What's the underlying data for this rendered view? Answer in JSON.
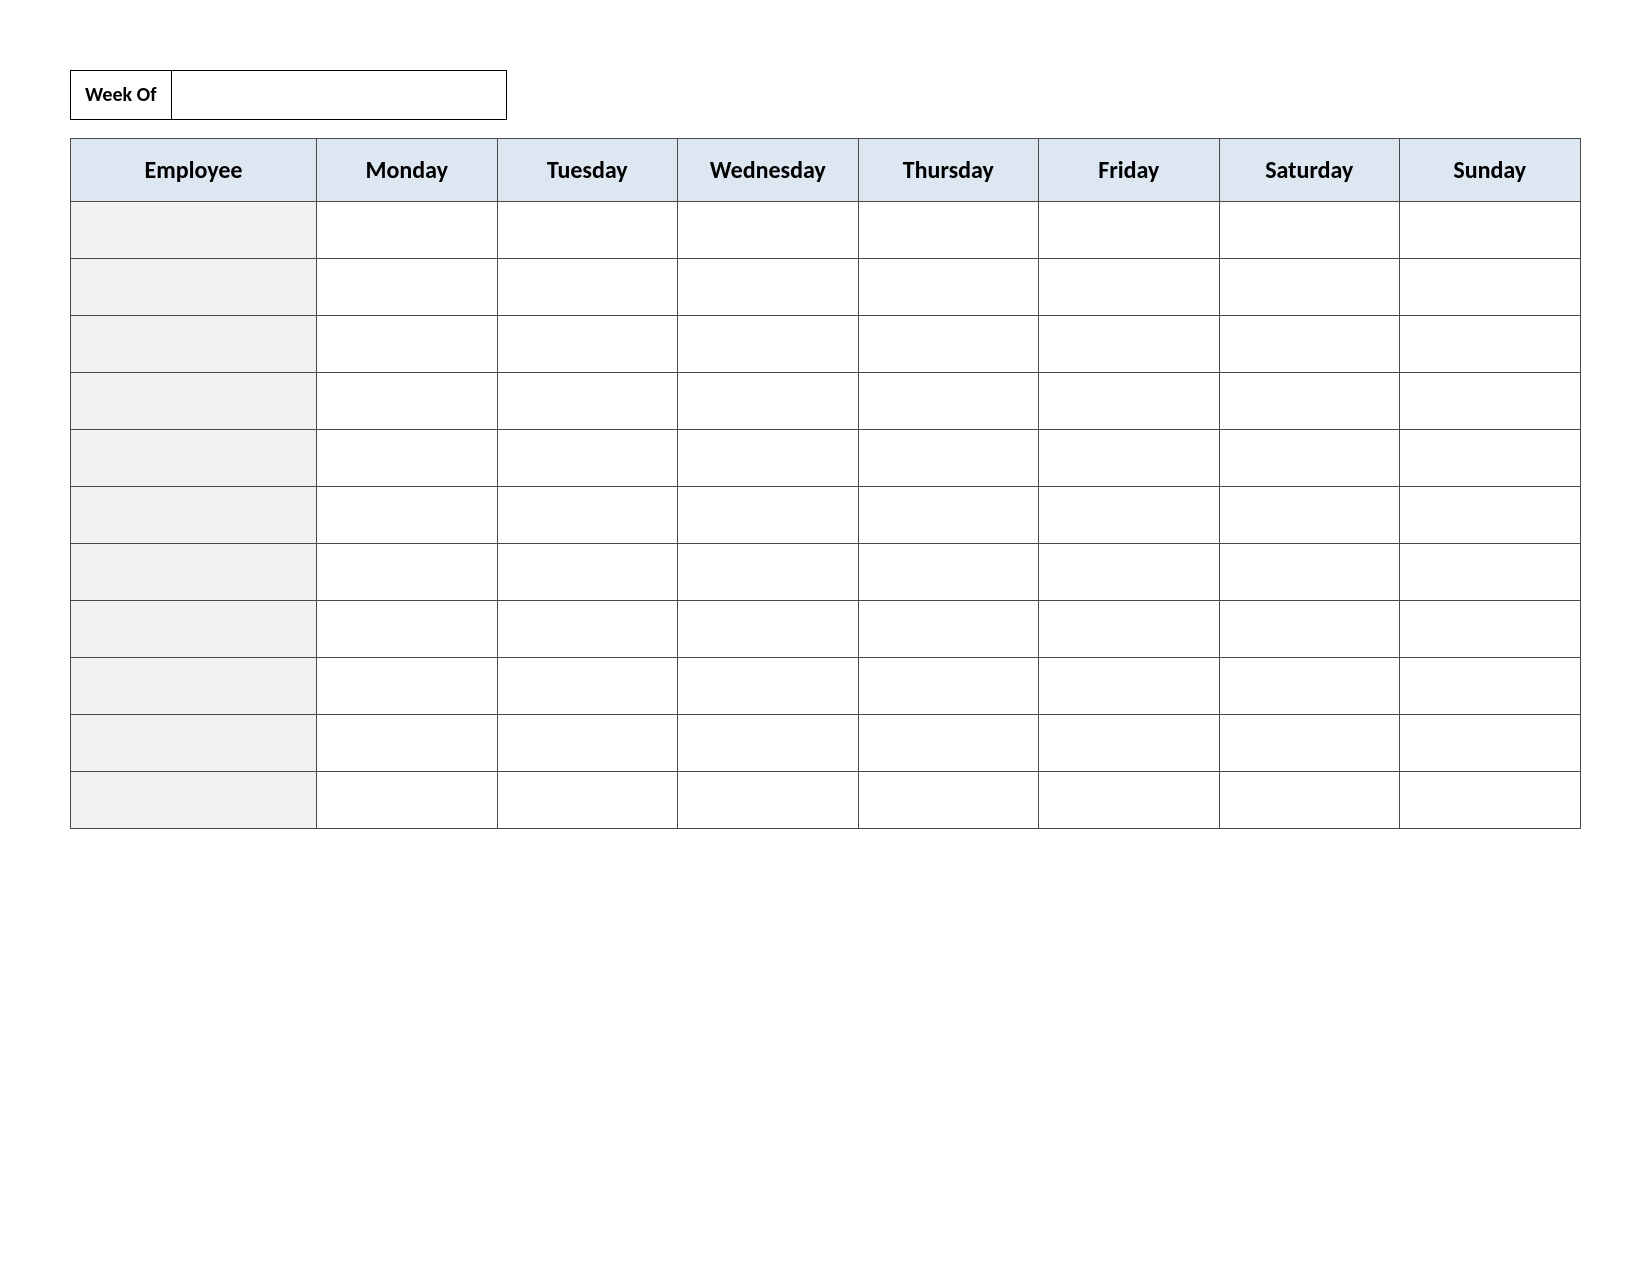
{
  "weekof": {
    "label": "Week Of",
    "value": ""
  },
  "schedule": {
    "columns": [
      "Employee",
      "Monday",
      "Tuesday",
      "Wednesday",
      "Thursday",
      "Friday",
      "Saturday",
      "Sunday"
    ],
    "rows": [
      {
        "employee": "",
        "monday": "",
        "tuesday": "",
        "wednesday": "",
        "thursday": "",
        "friday": "",
        "saturday": "",
        "sunday": ""
      },
      {
        "employee": "",
        "monday": "",
        "tuesday": "",
        "wednesday": "",
        "thursday": "",
        "friday": "",
        "saturday": "",
        "sunday": ""
      },
      {
        "employee": "",
        "monday": "",
        "tuesday": "",
        "wednesday": "",
        "thursday": "",
        "friday": "",
        "saturday": "",
        "sunday": ""
      },
      {
        "employee": "",
        "monday": "",
        "tuesday": "",
        "wednesday": "",
        "thursday": "",
        "friday": "",
        "saturday": "",
        "sunday": ""
      },
      {
        "employee": "",
        "monday": "",
        "tuesday": "",
        "wednesday": "",
        "thursday": "",
        "friday": "",
        "saturday": "",
        "sunday": ""
      },
      {
        "employee": "",
        "monday": "",
        "tuesday": "",
        "wednesday": "",
        "thursday": "",
        "friday": "",
        "saturday": "",
        "sunday": ""
      },
      {
        "employee": "",
        "monday": "",
        "tuesday": "",
        "wednesday": "",
        "thursday": "",
        "friday": "",
        "saturday": "",
        "sunday": ""
      },
      {
        "employee": "",
        "monday": "",
        "tuesday": "",
        "wednesday": "",
        "thursday": "",
        "friday": "",
        "saturday": "",
        "sunday": ""
      },
      {
        "employee": "",
        "monday": "",
        "tuesday": "",
        "wednesday": "",
        "thursday": "",
        "friday": "",
        "saturday": "",
        "sunday": ""
      },
      {
        "employee": "",
        "monday": "",
        "tuesday": "",
        "wednesday": "",
        "thursday": "",
        "friday": "",
        "saturday": "",
        "sunday": ""
      },
      {
        "employee": "",
        "monday": "",
        "tuesday": "",
        "wednesday": "",
        "thursday": "",
        "friday": "",
        "saturday": "",
        "sunday": ""
      }
    ]
  }
}
